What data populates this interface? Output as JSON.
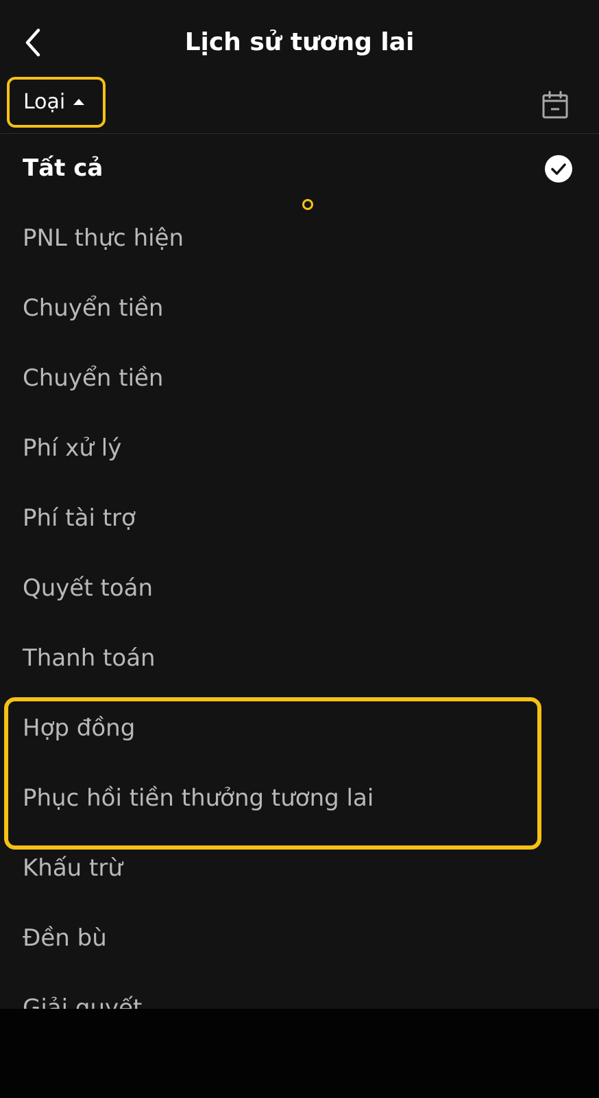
{
  "header": {
    "title": "Lịch sử tương lai",
    "back_icon": "chevron-left-icon"
  },
  "filter": {
    "type_label": "Loại",
    "caret_icon": "caret-up-icon",
    "calendar_icon": "calendar-icon"
  },
  "options": [
    {
      "label": "Tất cả",
      "selected": true
    },
    {
      "label": "PNL thực hiện",
      "selected": false
    },
    {
      "label": "Chuyển tiền",
      "selected": false
    },
    {
      "label": "Chuyển tiền",
      "selected": false
    },
    {
      "label": "Phí xử lý",
      "selected": false
    },
    {
      "label": "Phí tài trợ",
      "selected": false
    },
    {
      "label": "Quyết toán",
      "selected": false
    },
    {
      "label": "Thanh toán",
      "selected": false
    },
    {
      "label": "Hợp đồng",
      "selected": false
    },
    {
      "label": "Phục hồi tiền thưởng tương lai",
      "selected": false
    },
    {
      "label": "Khấu trừ",
      "selected": false
    },
    {
      "label": "Đền bù",
      "selected": false
    },
    {
      "label": "Giải quyết",
      "selected": false
    }
  ],
  "colors": {
    "background": "#131313",
    "accent": "#f5c114",
    "text_selected": "#ffffff",
    "text_normal": "#b9b9b9"
  }
}
